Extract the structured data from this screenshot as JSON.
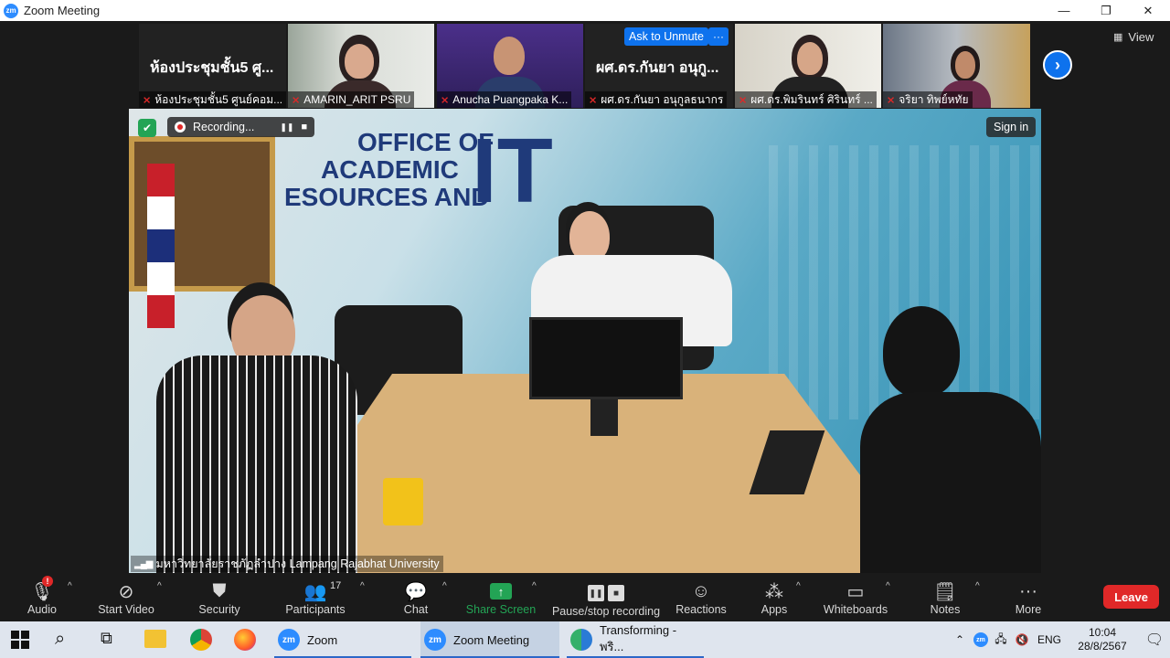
{
  "window": {
    "title": "Zoom Meeting",
    "minimize": "—",
    "restore": "❐",
    "close": "✕"
  },
  "thumbnails": [
    {
      "big_name": "ห้องประชุมชั้น5 ศู...",
      "label": "ห้องประชุมชั้น5 ศูนย์คอม..."
    },
    {
      "label": "AMARIN_ARIT PSRU"
    },
    {
      "label": "Anucha Puangpaka K..."
    },
    {
      "big_name": "ผศ.ดร.กันยา อนุกู...",
      "label": "ผศ.ดร.กันยา อนุกูลธนากร"
    },
    {
      "label": "ผศ.ดร.พิมรินทร์ ศิรินทร์ ..."
    },
    {
      "label": "จริยา  ทิพย์หทัย"
    }
  ],
  "ask_unmute": "Ask to Unmute",
  "more_dots": "···",
  "view_label": "View",
  "recording": {
    "label": "Recording...",
    "pause": "❚❚",
    "stop": "■"
  },
  "sign_in": "Sign in",
  "speaker_label": "มหาวิทยาลัยราชภัฏลำปาง Lampang Rajabhat University",
  "background_sign": {
    "line1": "OFFICE OF",
    "line2": "ACADEMIC",
    "line3": "ESOURCES AND",
    "big": "IT"
  },
  "toolbar": {
    "audio": "Audio",
    "start_video": "Start Video",
    "security": "Security",
    "participants": "Participants",
    "participants_count": "17",
    "chat": "Chat",
    "share_screen": "Share Screen",
    "pause_recording": "Pause/stop recording",
    "reactions": "Reactions",
    "apps": "Apps",
    "whiteboards": "Whiteboards",
    "notes": "Notes",
    "more": "More",
    "leave": "Leave",
    "audio_badge": "!"
  },
  "taskbar": {
    "zoom_label": "Zoom",
    "zoom_meeting_label": "Zoom Meeting",
    "browser_label": "Transforming - พริ...",
    "lang": "ENG",
    "time": "10:04",
    "date": "28/8/2567"
  },
  "colors": {
    "accent": "#2D8CFF",
    "leave": "#e02828",
    "share": "#23a455"
  }
}
